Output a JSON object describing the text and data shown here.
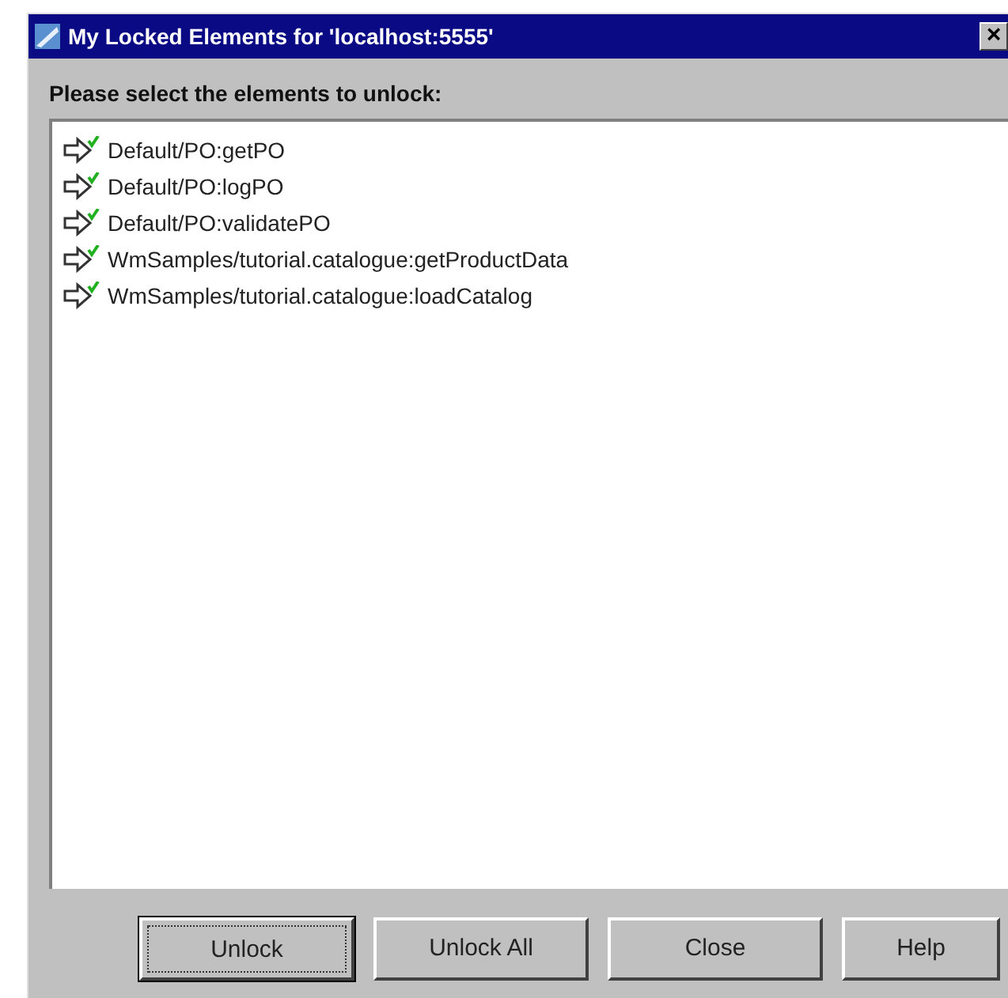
{
  "window": {
    "title": "My Locked Elements for 'localhost:5555'",
    "close": "×"
  },
  "prompt": "Please select the elements to unlock:",
  "elements": [
    {
      "label": "Default/PO:getPO",
      "selected": false
    },
    {
      "label": "Default/PO:logPO",
      "selected": false
    },
    {
      "label": "Default/PO:validatePO",
      "selected": false
    },
    {
      "label": "WmSamples/tutorial.catalogue:getProductData",
      "selected": false
    },
    {
      "label": "WmSamples/tutorial.catalogue:loadCatalog",
      "selected": false
    }
  ],
  "buttons": [
    {
      "label": "Unlock",
      "focused": true
    },
    {
      "label": "Unlock All",
      "focused": false
    },
    {
      "label": "Close",
      "focused": false
    },
    {
      "label": "Help",
      "focused": false
    }
  ]
}
